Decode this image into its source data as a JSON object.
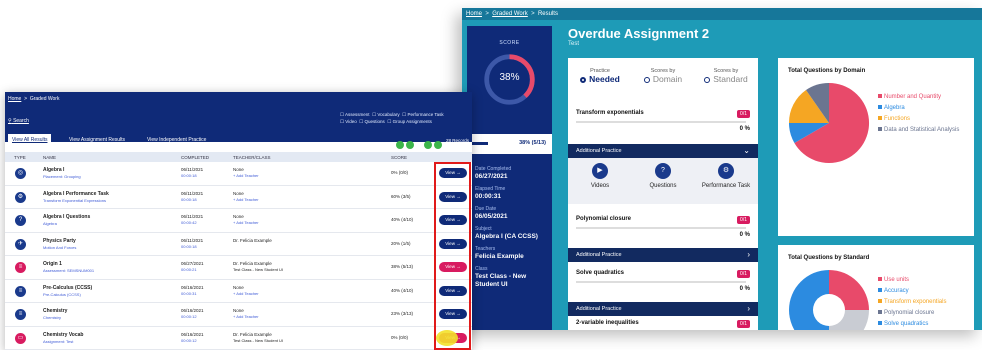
{
  "right": {
    "breadcrumb": [
      "Home",
      "Graded Work",
      "Results"
    ],
    "score_label": "SCORE",
    "score_pct": "38%",
    "score_fraction": 0.38,
    "score_detail": "38% (5/13)",
    "date_completed_label": "Date Completed",
    "date_completed": "06/27/2021",
    "elapsed_label": "Elapsed Time",
    "elapsed": "00:00:31",
    "due_label": "Due Date",
    "due": "06/05/2021",
    "subject_label": "Subject",
    "subject": "Algebra I (CA CCSS)",
    "teacher_label": "Teachers",
    "teacher": "Felicia Example",
    "class_label": "Class",
    "class": "Test Class - New Student UI",
    "title": "Overdue Assignment 2",
    "subtitle": "Test",
    "tabs": [
      {
        "small": "Practice",
        "big": "Needed"
      },
      {
        "small": "Scores by",
        "big": "Domain"
      },
      {
        "small": "Scores by",
        "big": "Standard"
      }
    ],
    "skills": [
      {
        "name": "Transform exponentials",
        "badge": "0/1",
        "pct": "0 %"
      },
      {
        "name": "Polynomial closure",
        "badge": "0/1",
        "pct": "0 %"
      },
      {
        "name": "Solve quadratics",
        "badge": "0/1",
        "pct": "0 %"
      },
      {
        "name": "2-variable inequalities",
        "badge": "0/1"
      }
    ],
    "additional_practice": "Additional Practice",
    "practice_items": [
      "Videos",
      "Questions",
      "Performance Task"
    ],
    "chart1": {
      "title": "Total Questions by Domain",
      "legend": [
        {
          "label": "Number and Quantity",
          "color": "#e84a6a"
        },
        {
          "label": "Algebra",
          "color": "#2c8be0"
        },
        {
          "label": "Functions",
          "color": "#f5a623"
        },
        {
          "label": "Data and Statistical Analysis",
          "color": "#6b7590"
        }
      ]
    },
    "chart2": {
      "title": "Total Questions by Standard",
      "legend": [
        {
          "label": "Use units",
          "color": "#e84a6a"
        },
        {
          "label": "Accuracy",
          "color": "#2c8be0"
        },
        {
          "label": "Transform exponentials",
          "color": "#f5a623"
        },
        {
          "label": "Polynomial closure",
          "color": "#6b7590"
        },
        {
          "label": "Solve quadratics",
          "color": "#2c8be0"
        }
      ]
    }
  },
  "left": {
    "breadcrumb": [
      "Home",
      "Graded Work"
    ],
    "search": "Search",
    "filters": [
      "Assessment",
      "Vocabulary",
      "Performance Task",
      "Video",
      "Questions",
      "Group Assignments"
    ],
    "tabs": [
      "View All Results",
      "View Assignment Results",
      "View Independent Practice"
    ],
    "records": "28 Records",
    "columns": [
      "TYPE",
      "NAME",
      "COMPLETED",
      "TEACHER/CLASS",
      "SCORE"
    ],
    "view_label": "View",
    "rows": [
      {
        "name": "Algebra I",
        "sub": "Placement: Grouping",
        "date": "06/11/2021",
        "time": "00:00:18",
        "teacher": "None",
        "class": "+ Add Teacher",
        "score": "0% (0/0)"
      },
      {
        "name": "Algebra I Performance Task",
        "sub": "Transform Exponential Expressions",
        "date": "06/11/2021",
        "time": "00:00:18",
        "teacher": "None",
        "class": "+ Add Teacher",
        "score": "60% (3/5)"
      },
      {
        "name": "Algebra I Questions",
        "sub": "Algebra",
        "date": "06/11/2021",
        "time": "00:00:42",
        "teacher": "None",
        "class": "+ Add Teacher",
        "score": "40% (4/10)"
      },
      {
        "name": "Physics Party",
        "sub": "Motion And Forces",
        "date": "06/11/2021",
        "time": "00:00:18",
        "teacher": "Dr. Felicia Example",
        "class": "",
        "score": "20% (1/5)"
      },
      {
        "name": "Origin 1",
        "sub": "Assessment: SEMSNUM001",
        "date": "06/27/2021",
        "time": "00:00:21",
        "teacher": "Dr. Felicia Example",
        "class": "Test Class - New Student UI",
        "score": "38% (5/13)"
      },
      {
        "name": "Pre-Calculus (CCSS)",
        "sub": "Pre-Calculus (CCSS)",
        "date": "06/16/2021",
        "time": "00:00:31",
        "teacher": "None",
        "class": "+ Add Teacher",
        "score": "40% (4/10)"
      },
      {
        "name": "Chemistry",
        "sub": "Chemistry",
        "date": "06/16/2021",
        "time": "00:00:12",
        "teacher": "None",
        "class": "+ Add Teacher",
        "score": "23% (3/13)"
      },
      {
        "name": "Chemistry Vocab",
        "sub": "Assignment: Test",
        "date": "06/16/2021",
        "time": "00:00:12",
        "teacher": "Dr. Felicia Example",
        "class": "Test Class - New Student UI",
        "score": "0% (0/0)"
      }
    ]
  }
}
